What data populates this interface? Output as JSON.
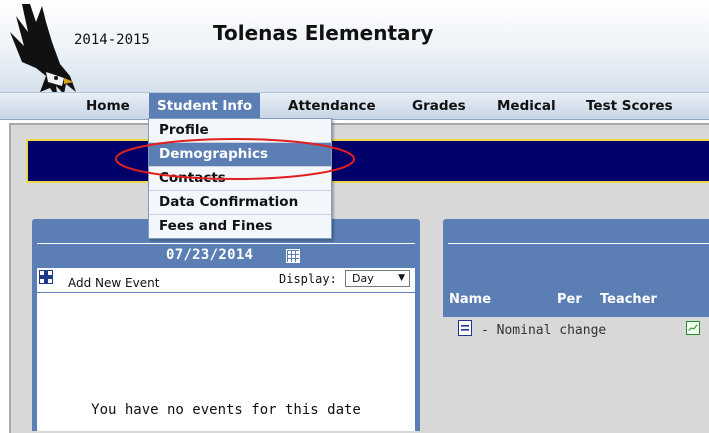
{
  "header": {
    "school_year": "2014-2015",
    "school_name": "Tolenas Elementary"
  },
  "nav": {
    "items": [
      {
        "label": "Home"
      },
      {
        "label": "Student Info",
        "active": true
      },
      {
        "label": "Attendance"
      },
      {
        "label": "Grades"
      },
      {
        "label": "Medical"
      },
      {
        "label": "Test Scores"
      }
    ]
  },
  "dropdown": {
    "items": [
      {
        "label": "Profile"
      },
      {
        "label": "Demographics",
        "highlighted": true
      },
      {
        "label": "Contacts"
      },
      {
        "label": "Data Confirmation"
      },
      {
        "label": "Fees and Fines"
      }
    ]
  },
  "calendar": {
    "date": "07/23/2014",
    "add_label": "Add New Event",
    "display_label": "Display:",
    "display_value": "Day",
    "empty_message": "You have no events for this date"
  },
  "grades": {
    "columns": {
      "name": "Name",
      "per": "Per",
      "teacher": "Teacher"
    },
    "note": "- Nominal change"
  },
  "colors": {
    "accent": "#5b7fb5",
    "banner": "#00006b",
    "banner_border": "#e8d84a",
    "annotation_circle": "#e02020"
  }
}
